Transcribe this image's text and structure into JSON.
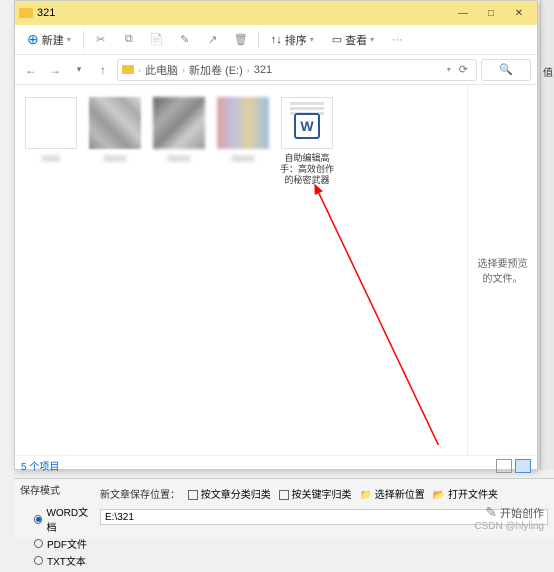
{
  "window": {
    "title": "321",
    "min": "—",
    "max": "□",
    "close": "✕"
  },
  "toolbar": {
    "new_label": "新建",
    "cut": "✂",
    "copy": "⧉",
    "paste": "📋",
    "rename": "✎",
    "share": "↗",
    "delete": "🗑",
    "sort_label": "排序",
    "view_label": "查看",
    "more": "···"
  },
  "nav": {
    "back": "←",
    "fwd": "→",
    "up": "↑",
    "refresh": "⟳"
  },
  "breadcrumb": {
    "seg1": "此电脑",
    "seg2": "新加卷 (E:)",
    "seg3": "321"
  },
  "files": {
    "doc_label": "自助编辑高手：高效创作的秘密武器",
    "word_letter": "W"
  },
  "preview_pane": {
    "text": "选择要预览的文件。"
  },
  "status": {
    "count": "5 个项目"
  },
  "panel": {
    "save_mode": "保存模式",
    "r_word": "WORD文档",
    "r_pdf": "PDF文件",
    "r_txt": "TXT文本",
    "save_loc_label": "新文章保存位置：",
    "chk1": "按文章分类归类",
    "chk2": "按关键字归类",
    "btn_select": "选择新位置",
    "btn_open": "打开文件夹",
    "path_value": "E:\\321",
    "start_create": "开始创作",
    "watermark": "CSDN @hlyling"
  },
  "side": {
    "val": "值"
  }
}
